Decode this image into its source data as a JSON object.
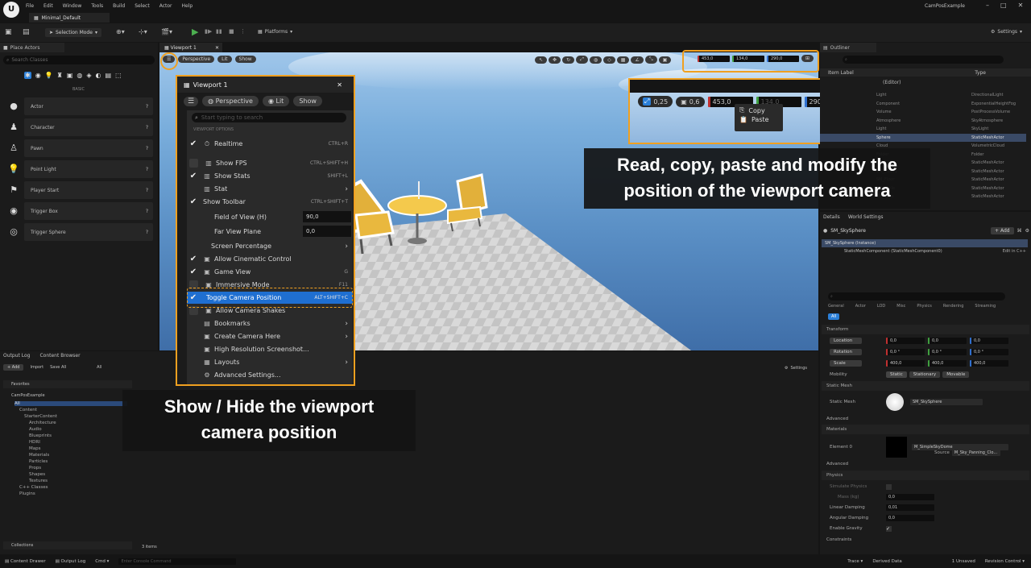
{
  "menubar": {
    "items": [
      "File",
      "Edit",
      "Window",
      "Tools",
      "Build",
      "Select",
      "Actor",
      "Help"
    ],
    "project": "CamPosExample"
  },
  "tab": {
    "level": "Minimal_Default"
  },
  "toolbar": {
    "selection_mode": "Selection Mode",
    "platforms": "Platforms",
    "settings": "Settings"
  },
  "place_actors": {
    "title": "Place Actors",
    "search_placeholder": "Search Classes",
    "category": "BASIC",
    "items": [
      "Actor",
      "Character",
      "Pawn",
      "Point Light",
      "Player Start",
      "Trigger Box",
      "Trigger Sphere"
    ]
  },
  "viewport": {
    "tab": "Viewport 1",
    "perspective": "Perspective",
    "lit": "Lit",
    "show": "Show",
    "cam_x": "453,0",
    "cam_y": "134,0",
    "cam_z": "290,0"
  },
  "zoom_panel": {
    "scale": "0,25",
    "speed": "0,6",
    "x": "453,0",
    "y": "134,0",
    "z": "290,0",
    "copy": "Copy",
    "paste": "Paste"
  },
  "menu": {
    "tab": "Viewport 1",
    "perspective": "Perspective",
    "lit": "Lit",
    "show": "Show",
    "search_placeholder": "Start typing to search",
    "section": "VIEWPORT OPTIONS",
    "realtime": "Realtime",
    "realtime_sc": "CTRL+R",
    "show_fps": "Show FPS",
    "show_fps_sc": "CTRL+SHIFT+H",
    "show_stats": "Show Stats",
    "show_stats_sc": "SHIFT+L",
    "stat": "Stat",
    "show_toolbar": "Show Toolbar",
    "show_toolbar_sc": "CTRL+SHIFT+T",
    "fov": "Field of View (H)",
    "fov_val": "90,0",
    "far": "Far View Plane",
    "far_val": "0,0",
    "screen_pct": "Screen Percentage",
    "cinematic": "Allow Cinematic Control",
    "game_view": "Game View",
    "game_view_sc": "G",
    "immersive": "Immersive Mode",
    "immersive_sc": "F11",
    "toggle_cam": "Toggle Camera Position",
    "toggle_cam_sc": "ALT+SHIFT+C",
    "cam_shakes": "Allow Camera Shakes",
    "bookmarks": "Bookmarks",
    "create_cam": "Create Camera Here",
    "hires": "High Resolution Screenshot...",
    "layouts": "Layouts",
    "advanced": "Advanced Settings..."
  },
  "captions": {
    "top_line1": "Read, copy, paste and modify the",
    "top_line2": "position of the viewport camera",
    "bottom_line1": "Show / Hide the viewport",
    "bottom_line2": "camera position"
  },
  "outliner": {
    "title": "Outliner",
    "col_label": "Item Label",
    "col_type": "Type",
    "world": "(Editor)",
    "rows": [
      [
        "Light",
        "DirectionalLight"
      ],
      [
        "Component",
        "ExponentialHeightFog"
      ],
      [
        "Volume",
        "PostProcessVolume"
      ],
      [
        "Atmosphere",
        "SkyAtmosphere"
      ],
      [
        "Light",
        "SkyLight"
      ],
      [
        "Sphere",
        "StaticMeshActor"
      ],
      [
        "Cloud",
        "VolumetricCloud"
      ],
      [
        "Folder",
        "Folder"
      ],
      [
        "SM_Chair",
        "StaticMeshActor"
      ],
      [
        "SM_Chair2",
        "StaticMeshActor"
      ],
      [
        "SM_Floor",
        "StaticMeshActor"
      ],
      [
        "SM_Table",
        "StaticMeshActor"
      ],
      [
        "SM_Vase",
        "StaticMeshActor"
      ]
    ]
  },
  "details": {
    "tab_details": "Details",
    "tab_world": "World Settings",
    "object": "SM_SkySphere",
    "add": "+ Add",
    "instance": "SM_SkySphere (Instance)",
    "component": "StaticMeshComponent (StaticMeshComponent0)",
    "edit_cpp": "Edit in C++",
    "filter_tabs": [
      "General",
      "Actor",
      "LOD",
      "Misc",
      "Physics",
      "Rendering",
      "Streaming"
    ],
    "all": "All",
    "transform": "Transform",
    "location": "Location",
    "rotation": "Rotation",
    "scale": "Scale",
    "loc": [
      "0,0",
      "0,0",
      "0,0"
    ],
    "rot": [
      "0,0 °",
      "0,0 °",
      "0,0 °"
    ],
    "scl": [
      "400,0",
      "400,0",
      "400,0"
    ],
    "mobility": "Mobility",
    "mob_opts": [
      "Static",
      "Stationary",
      "Movable"
    ],
    "static_mesh_section": "Static Mesh",
    "static_mesh": "Static Mesh",
    "mesh_val": "SM_SkySphere",
    "advanced": "Advanced",
    "materials": "Materials",
    "element0": "Element 0",
    "mat_val": "M_SimpleSkyDome",
    "mat_src": "Source",
    "mat_src_val": "M_Sky_Panning_Clo...",
    "physics": "Physics",
    "simulate": "Simulate Physics",
    "mass": "Mass (kg)",
    "mass_val": "0,0",
    "linear": "Linear Damping",
    "linear_val": "0,01",
    "angular": "Angular Damping",
    "angular_val": "0,0",
    "gravity": "Enable Gravity",
    "constraints": "Constraints"
  },
  "bottom": {
    "output_log": "Output Log",
    "content_browser": "Content Browser",
    "add": "+ Add",
    "import": "Import",
    "save_all": "Save All",
    "all": "All",
    "settings": "Settings",
    "favorites": "Favorites",
    "project": "CamPosExample",
    "collections": "Collections",
    "items": "3 items",
    "tree": [
      "All",
      "Content",
      "StarterContent",
      "Architecture",
      "Audio",
      "Blueprints",
      "HDRI",
      "Maps",
      "Materials",
      "Particles",
      "Props",
      "Shapes",
      "Textures",
      "C++ Classes",
      "Plugins"
    ]
  },
  "statusbar": {
    "content_drawer": "Content Drawer",
    "output_log": "Output Log",
    "cmd": "Cmd",
    "cmd_placeholder": "Enter Console Command",
    "trace": "Trace",
    "derived": "Derived Data",
    "unsaved": "1 Unsaved",
    "revision": "Revision Control"
  }
}
